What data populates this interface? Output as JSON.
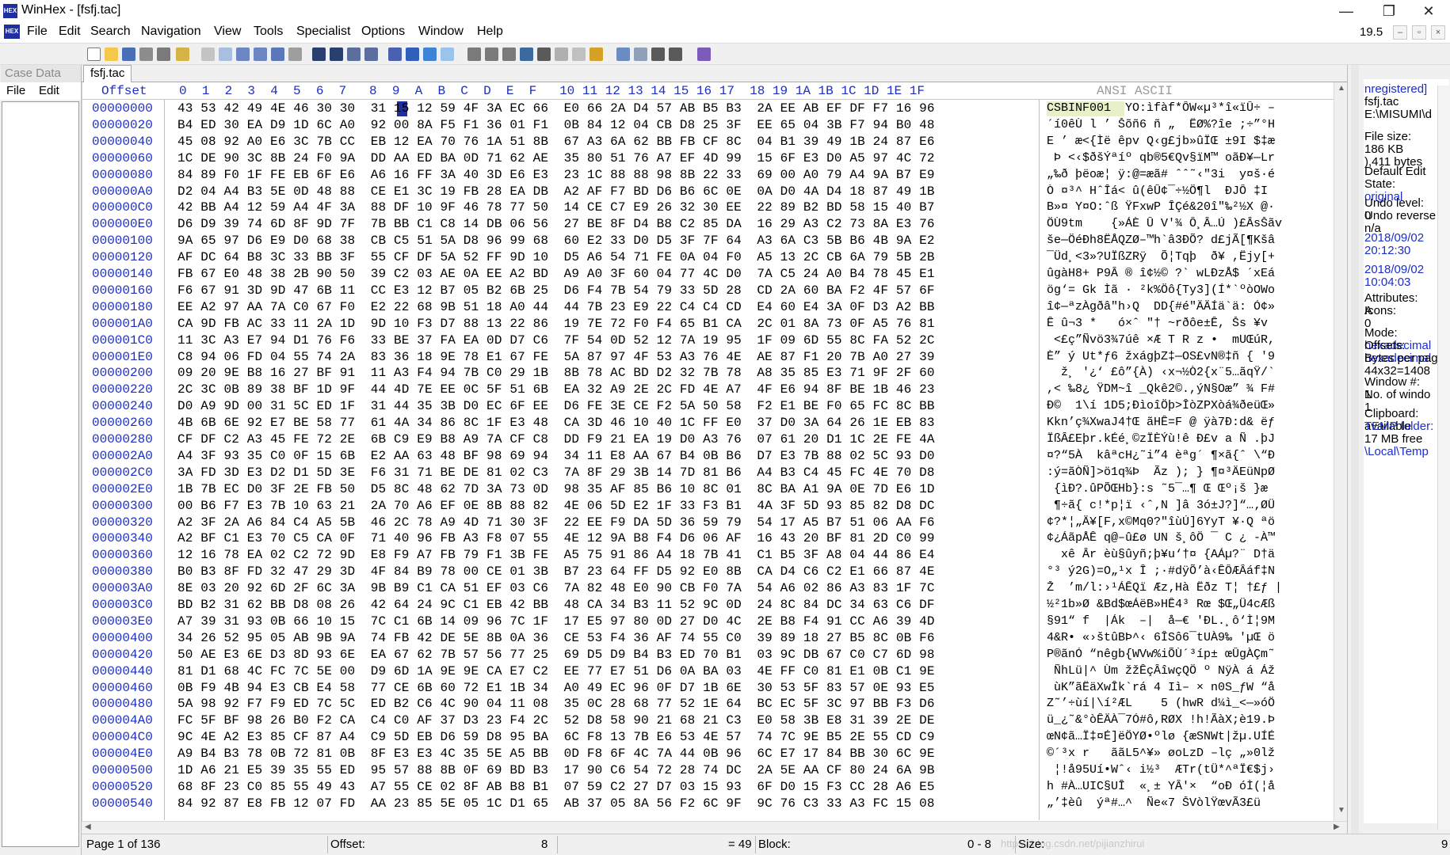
{
  "window": {
    "title": "WinHex - [fsfj.tac]",
    "app_icon_text": "HEX",
    "minimize": "—",
    "restore": "❐",
    "close": "✕"
  },
  "menu": {
    "items": [
      "File",
      "Edit",
      "Search",
      "Navigation",
      "View",
      "Tools",
      "Specialist",
      "Options",
      "Window",
      "Help"
    ],
    "version": "19.5",
    "mdi_controls": [
      "–",
      "▫",
      "×"
    ]
  },
  "case_data": {
    "title": "Case Data",
    "menu_file": "File",
    "menu_edit": "Edit"
  },
  "tab": {
    "label": "fsfj.tac"
  },
  "hex": {
    "offset_header": "Offset",
    "column_header": "0  1  2  3  4  5  6  7   8  9  A  B  C  D  E  F   10 11 12 13 14 15 16 17  18 19 1A 1B 1C 1D 1E 1F",
    "ascii_header": "ANSI ASCII",
    "rows": [
      {
        "offset": "00000000",
        "hex": "43 53 42 49 4E 46 30 30  31 15 12 59 4F 3A EC 66  E0 66 2A D4 57 AB B5 B3  2A EE AB EF DF F7 16 96",
        "ascii": "CSBINF001  YO:ìfàf*ÔW«µ³*î«ïÛ÷ –"
      },
      {
        "offset": "00000020",
        "hex": "B4 ED 30 EA D9 1D 6C A0  92 00 8A F5 F1 36 01 F1  0B 84 12 04 CB D8 25 3F  EE 65 04 3B F7 94 B0 48",
        "ascii": "´í0êÙ l ’ Šõñ6 ñ „  ËØ%?îe ;÷”°H"
      },
      {
        "offset": "00000040",
        "hex": "45 08 92 A0 E6 3C 7B CC  EB 12 EA 70 76 1A 51 8B  67 A3 6A 62 BB FB CF 8C  04 B1 39 49 1B 24 87 E6",
        "ascii": "E ’ æ<{Ìë êpv Q‹g£jb»ûÏŒ ±9I $‡æ"
      },
      {
        "offset": "00000060",
        "hex": "1C DE 90 3C 8B 24 F0 9A  DD AA ED BA 0D 71 62 AE  35 80 51 76 A7 EF 4D 99  15 6F E3 D0 A5 97 4C 72",
        "ascii": " Þ <‹$ðšÝªíº qb®5€Qv§ïM™ oãÐ¥—Lr"
      },
      {
        "offset": "00000080",
        "hex": "84 89 F0 1F FE EB 6F E6  A6 16 FF 3A 40 3D E6 E3  23 1C 88 88 98 8B 22 33  69 00 A0 79 A4 9A B7 E9",
        "ascii": "„‰ð þëoæ¦ ÿ:@=æã# ˆˆ˜‹\"3i  y¤š·é"
      },
      {
        "offset": "000000A0",
        "hex": "D2 04 A4 B3 5E 0D 48 88  CE E1 3C 19 FB 28 EA DB  A2 AF F7 BD D6 B6 6C 0E  0A D0 4A D4 18 87 49 1B",
        "ascii": "Ò ¤³^ HˆÎá< û(êÛ¢¯÷½Ö¶l  ÐJÔ ‡I "
      },
      {
        "offset": "000000C0",
        "hex": "42 BB A4 12 59 A4 4F 3A  88 DF 10 9F 46 78 77 50  14 CE C7 E9 26 32 30 EE  22 89 B2 BD 58 15 40 B7",
        "ascii": "B»¤ Y¤O:ˆß ŸFxwP ÎÇé&20î\"‰²½X @·"
      },
      {
        "offset": "000000E0",
        "hex": "D6 D9 39 74 6D 8F 9D 7F  7B BB C1 C8 14 DB 06 56  27 BE 8F D4 B8 C2 85 DA  16 29 A3 C2 73 8A E3 76",
        "ascii": "ÖÙ9tm    {»ÁÈ Û V'¾ Ô¸Â…Ú )£ÂsŠãv"
      },
      {
        "offset": "00000100",
        "hex": "9A 65 97 D6 E9 D0 68 38  CB C5 51 5A D8 96 99 68  60 E2 33 D0 D5 3F 7F 64  A3 6A C3 5B B6 4B 9A E2",
        "ascii": "še—ÖéÐh8ËÅQZØ–™h`â3ÐÕ? d£jÃ[¶Kšâ"
      },
      {
        "offset": "00000120",
        "hex": "AF DC 64 B8 3C 33 BB 3F  55 CF DF 5A 52 FF 9D 10  D5 A6 54 71 FE 0A 04 F0  A5 13 2C CB 6A 79 5B 2B",
        "ascii": "¯Üd¸<3»?UÏßZRÿ  Õ¦Tqþ  ð¥ ,Ëjy[+"
      },
      {
        "offset": "00000140",
        "hex": "FB 67 E0 48 38 2B 90 50  39 C2 03 AE 0A EE A2 BD  A9 A0 3F 60 04 77 4C D0  7A C5 24 A0 B4 78 45 E1",
        "ascii": "ûgàH8+ P9Â ® î¢½© ?` wLÐzÅ$ ´xEá"
      },
      {
        "offset": "00000160",
        "hex": "F6 67 91 3D 9D 47 6B 11  CC E3 12 B7 05 B2 6B 25  D6 F4 7B 54 79 33 5D 28  CD 2A 60 BA F2 4F 57 6F",
        "ascii": "ög‘= Gk Ìã · ²k%Öô{Ty3](Í*`ºòOWo"
      },
      {
        "offset": "00000180",
        "hex": "EE A2 97 AA 7A C0 67 F0  E2 22 68 9B 51 18 A0 44  44 7B 23 E9 22 C4 C4 CD  E4 60 E4 3A 0F D3 A2 BB",
        "ascii": "î¢—ªzÀgðâ\"h›Q  DD{#é\"ÄÄÍä`ä: Ó¢»"
      },
      {
        "offset": "000001A0",
        "hex": "CA 9D FB AC 33 11 2A 1D  9D 10 F3 D7 88 13 22 86  19 7E 72 F0 F4 65 B1 CA  2C 01 8A 73 0F A5 76 81",
        "ascii": "Ê û¬3 *   ó×ˆ \"† ~rðôe±Ê, Šs ¥v "
      },
      {
        "offset": "000001C0",
        "hex": "11 3C A3 E7 94 D1 76 F6  33 BE 37 FA EA 0D D7 C6  7F 54 0D 52 12 7A 19 95  1F 09 6D 55 8C FA 52 2C",
        "ascii": " <£ç”Ñvö3¾7úê ×Æ T R z •  mUŒúR,"
      },
      {
        "offset": "000001E0",
        "hex": "C8 94 06 FD 04 55 74 2A  83 36 18 9E 78 E1 67 FE  5A 87 97 4F 53 A3 76 4E  AE 87 F1 20 7B A0 27 39",
        "ascii": "È” ý Ut*ƒ6 žxágþZ‡—OS£vN®‡ñ { '9"
      },
      {
        "offset": "00000200",
        "hex": "09 20 9E B8 16 27 BF 91  11 A3 F4 94 7B C0 29 1B  8B 78 AC BD D2 32 7B 78  A8 35 85 E3 71 9F 2F 60",
        "ascii": "  ž¸ '¿‘ £ô”{À) ‹x¬½Ò2{x¨5…ãqŸ/`"
      },
      {
        "offset": "00000220",
        "hex": "2C 3C 0B 89 38 BF 1D 9F  44 4D 7E EE 0C 5F 51 6B  EA 32 A9 2E 2C FD 4E A7  4F E6 94 8F BE 1B 46 23",
        "ascii": ",< ‰8¿ ŸDM~î _Qkê2©.,ýN§Oæ” ¾ F#"
      },
      {
        "offset": "00000240",
        "hex": "D0 A9 9D 00 31 5C ED 1F  31 44 35 3B D0 EC 6F EE  D6 FE 3E CE F2 5A 50 58  F2 E1 BE F0 65 FC 8C BB",
        "ascii": "Ð©  1\\í 1D5;ÐìoîÖþ>ÎòZPXòá¾ðeüŒ»"
      },
      {
        "offset": "00000260",
        "hex": "4B 6B 6E 92 E7 BE 58 77  61 4A 34 86 8C 1F E3 48  CA 3D 46 10 40 1C FF E0  37 D0 3A 64 26 1E EB 83",
        "ascii": "Kkn’ç¾XwaJ4†Œ ãHÊ=F @ ÿà7Ð:d& ëƒ"
      },
      {
        "offset": "00000280",
        "hex": "CF DF C2 A3 45 FE 72 2E  6B C9 E9 B8 A9 7A CF C8  DD F9 21 EA 19 D0 A3 76  07 61 20 D1 1C 2E FE 4A",
        "ascii": "ÏßÂ£Eþr.kÉé¸©zÏÈÝù!ê Ð£v a Ñ .þJ"
      },
      {
        "offset": "000002A0",
        "hex": "A4 3F 93 35 C0 0F 15 6B  E2 AA 63 48 BF 98 69 94  34 11 E8 AA 67 B4 0B B6  D7 E3 7B 88 02 5C 93 D0",
        "ascii": "¤?“5À  kâªcH¿˜i”4 èªg´ ¶×ã{ˆ \\“Ð"
      },
      {
        "offset": "000002C0",
        "hex": "3A FD 3D E3 D2 D1 5D 3E  F6 31 71 BE DE 81 02 C3  7A 8F 29 3B 14 7D 81 B6  A4 B3 C4 45 FC 4E 70 D8",
        "ascii": ":ý=ãÒÑ]>ö1q¾Þ  Ãz ); } ¶¤³ÄEüNpØ"
      },
      {
        "offset": "000002E0",
        "hex": "1B 7B EC D0 3F 2E FB 50  D5 8C 48 62 7D 3A 73 0D  98 35 AF 85 B6 10 8C 01  8C BA A1 9A 0E 7D E6 1D",
        "ascii": " {ìÐ?.ûPÕŒHb}:s ˜5¯…¶ Œ Œº¡š }æ "
      },
      {
        "offset": "00000300",
        "hex": "00 B6 F7 E3 7B 10 63 21  2A 70 A6 EF 0E 8B 88 82  4E 06 5D E2 1F 33 F3 B1  4A 3F 5D 93 85 82 D8 DC",
        "ascii": " ¶÷ã{ c!*p¦ï ‹ˆ‚N ]â 3ó±J?]“…‚ØÜ"
      },
      {
        "offset": "00000320",
        "hex": "A2 3F 2A A6 84 C4 A5 5B  46 2C 78 A9 4D 71 30 3F  22 EE F9 DA 5D 36 59 79  54 17 A5 B7 51 06 AA F6",
        "ascii": "¢?*¦„Ä¥[F,x©Mq0?\"îùÚ]6YyT ¥·Q ªö"
      },
      {
        "offset": "00000340",
        "hex": "A2 BF C1 E3 70 C5 CA 0F  71 40 96 FB A3 F8 07 55  4E 12 9A B8 F4 D6 06 AF  16 43 20 BF 81 2D C0 99",
        "ascii": "¢¿ÁãpÅÊ q@–û£ø UN š¸ôÖ ¯ C ¿ -À™"
      },
      {
        "offset": "00000360",
        "hex": "12 16 78 EA 02 C2 72 9D  E8 F9 A7 FB 79 F1 3B FE  A5 75 91 86 A4 18 7B 41  C1 B5 3F A8 04 44 86 E4",
        "ascii": "  xê Âr èù§ûyñ;þ¥u‘†¤ {AÁµ?¨ D†ä"
      },
      {
        "offset": "00000380",
        "hex": "B0 B3 8F FD 32 47 29 3D  4F 84 B9 78 00 CE 01 3B  B7 23 64 FF D5 92 E0 8B  CA D4 C6 C2 E1 66 87 4E",
        "ascii": "°³ ý2G)=O„¹x Î ;·#dÿÕ’à‹ÊÔÆÂáf‡N"
      },
      {
        "offset": "000003A0",
        "hex": "8E 03 20 92 6D 2F 6C 3A  9B B9 C1 CA 51 EF 03 C6  7A 82 48 E0 90 CB F0 7A  54 A6 02 86 A3 83 1F 7C",
        "ascii": "Ž  ’m/l:›¹ÁÊQï Æz‚Hà Ëðz T¦ †£ƒ |"
      },
      {
        "offset": "000003C0",
        "hex": "BD B2 31 62 BB D8 08 26  42 64 24 9C C1 EB 42 BB  48 CA 34 B3 11 52 9C 0D  24 8C 84 DC 34 63 C6 DF",
        "ascii": "½²1b»Ø &Bd$œÁëB»HÊ4³ Rœ $Œ„Ü4cÆß"
      },
      {
        "offset": "000003E0",
        "hex": "A7 39 31 93 0B 66 10 15  7C C1 6B 14 09 96 7C 1F  17 E5 97 80 0D 27 D0 4C  2E B8 F4 91 CC A6 39 4D",
        "ascii": "§91“ f  |Ák  –|  å—€ 'ÐL.¸ô‘Ì¦9M"
      },
      {
        "offset": "00000400",
        "hex": "34 26 52 95 05 AB 9B 9A  74 FB 42 DE 5E 8B 0A 36  CE 53 F4 36 AF 74 55 C0  39 89 18 27 B5 8C 0B F6",
        "ascii": "4&R• «›štûBÞ^‹ 6ÎSô6¯tUÀ9‰ 'µŒ ö"
      },
      {
        "offset": "00000420",
        "hex": "50 AE E3 6E D3 8D 93 6E  EA 67 62 7B 57 56 77 25  69 D5 D9 B4 B3 ED 70 B1  03 9C DB 67 C0 C7 6D 98",
        "ascii": "P®ãnÓ “nêgb{WVw%iÕÙ´³íp± œÛgÀÇm˜"
      },
      {
        "offset": "00000440",
        "hex": "81 D1 68 4C FC 7C 5E 00  D9 6D 1A 9E 9E CA E7 C2  EE 77 E7 51 D6 0A BA 03  4E FF C0 81 E1 0B C1 9E",
        "ascii": " ÑhLü|^ Ùm žžÊçÂîwçQÖ º NÿÀ á Áž"
      },
      {
        "offset": "00000460",
        "hex": "0B F9 4B 94 E3 CB E4 58  77 CE 6B 60 72 E1 1B 34  A0 49 EC 96 0F D7 1B 6E  30 53 5F 83 57 0E 93 E5",
        "ascii": " ùK”ãËäXwÎk`rá 4 Iì– × n0S_ƒW “å"
      },
      {
        "offset": "00000480",
        "hex": "5A 98 92 F7 F9 ED 7C 5C  ED B2 C6 4C 90 04 11 08  35 0C 28 68 77 52 1E 64  BC EC 5F 3C 97 BB F3 D6",
        "ascii": "Z˜’÷ùí|\\í²ÆL    5 (hwR d¼ì_<—»óÖ"
      },
      {
        "offset": "000004A0",
        "hex": "FC 5F BF 98 26 B0 F2 CA  C4 C0 AF 37 D3 23 F4 2C  52 D8 58 90 21 68 21 C3  E0 58 3B E8 31 39 2E DE",
        "ascii": "ü_¿˜&°òÊÄÀ¯7Ó#ô,RØX !h!ÃàX;è19.Þ"
      },
      {
        "offset": "000004C0",
        "hex": "9C 4E A2 E3 85 CF 87 A4  C9 5D EB D6 59 D8 95 BA  6C F8 13 7B E6 53 4E 57  74 7C 9E B5 2E 55 CD C9",
        "ascii": "œN¢ã…Ï‡¤É]ëÖYØ•ºlø {æSNWt|žµ.UÍÉ"
      },
      {
        "offset": "000004E0",
        "hex": "A9 B4 B3 78 0B 72 81 0B  8F E3 E3 4C 35 5E A5 BB  0D F8 6F 4C 7A 44 0B 96  6C E7 17 84 BB 30 6C 9E",
        "ascii": "©´³x r   ããL5^¥» øoLzD –lç „»0lž"
      },
      {
        "offset": "00000500",
        "hex": "1D A6 21 E5 39 35 55 ED  95 57 88 8B 0F 69 BD B3  17 90 C6 54 72 28 74 DC  2A 5E AA CF 80 24 6A 9B",
        "ascii": " ¦!å95Uí•Wˆ‹ i½³  ÆTr(tÜ*^ªÏ€$j›"
      },
      {
        "offset": "00000520",
        "hex": "68 8F 23 C0 85 55 49 43  A7 55 CE 02 8F AB B8 B1  07 59 C2 27 D7 03 15 93  6F D0 15 F3 CC 28 A6 E5",
        "ascii": "h #À…UIC§UÎ  «¸± YÂ'×  “oÐ óÌ(¦å"
      },
      {
        "offset": "00000540",
        "hex": "84 92 87 E8 FB 12 07 FD  AA 23 85 5E 05 1C D1 65  AB 37 05 8A 56 F2 6C 9F  9C 76 C3 33 A3 FC 15 08",
        "ascii": "„’‡èû  ýª#…^  Ñe«7 ŠVòlŸœvÃ3£ü  "
      }
    ]
  },
  "info": {
    "lines": [
      "nregistered]",
      "fsfj.tac",
      "E:\\MISUMI\\d",
      "File size:",
      "186 KB",
      "),411 bytes",
      "Default Edit",
      "State:",
      "original",
      "Undo level:",
      "0",
      "Undo reverse",
      "n/a",
      "2018/09/02",
      "20:12:30",
      "2018/09/02",
      "10:04:03",
      "Attributes:",
      "A",
      "Icons:",
      "0",
      "Mode:",
      "hexadecimal",
      "Offsets:",
      "hexadecimal",
      "Bytes per page:",
      "44x32=1408",
      "Window #:",
      "1",
      "No. of windo",
      "1",
      "Clipboard:",
      "available",
      "TEMP folder:",
      "17 MB free",
      "\\Local\\Temp"
    ]
  },
  "status": {
    "page": "Page 1 of 136",
    "offset_label": "Offset:",
    "offset_value": "8",
    "value": "= 49",
    "block_label": "Block:",
    "block_value": "0 - 8",
    "size_label": "Size:",
    "size_value": "9",
    "watermark": "https://blog.csdn.net/pijianzhirui"
  },
  "colors": {
    "blue_text": "#1c2ec8",
    "selection": "#1f2fa0",
    "ascii_highlight": "#e7f0c8"
  }
}
